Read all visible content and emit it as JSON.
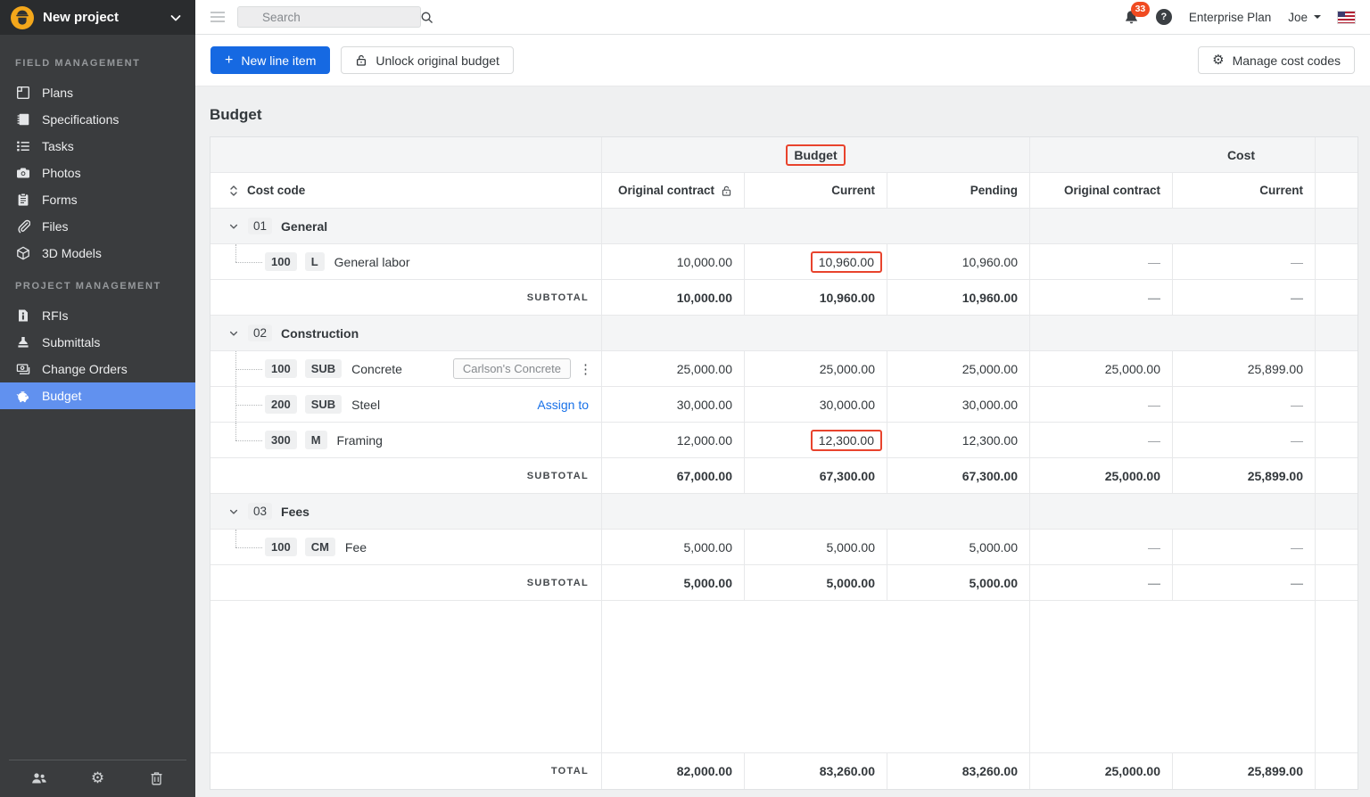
{
  "colors": {
    "accent_blue": "#1669E2",
    "sidebar_active_blue": "#6191EF",
    "annotation_red": "#E8432D",
    "notification_red": "#F04B21",
    "link_blue": "#1871E8"
  },
  "topbar": {
    "search_placeholder": "Search",
    "notification_count": "33",
    "help_label": "?",
    "plan_label": "Enterprise Plan",
    "user_name": "Joe"
  },
  "sidebar": {
    "project_name": "New project",
    "sections": [
      {
        "title": "FIELD MANAGEMENT",
        "items": [
          {
            "label": "Plans"
          },
          {
            "label": "Specifications"
          },
          {
            "label": "Tasks"
          },
          {
            "label": "Photos"
          },
          {
            "label": "Forms"
          },
          {
            "label": "Files"
          },
          {
            "label": "3D Models"
          }
        ]
      },
      {
        "title": "PROJECT MANAGEMENT",
        "items": [
          {
            "label": "RFIs"
          },
          {
            "label": "Submittals"
          },
          {
            "label": "Change Orders"
          },
          {
            "label": "Budget"
          }
        ]
      }
    ]
  },
  "toolbar": {
    "new_line_item": "New line item",
    "unlock_budget": "Unlock original budget",
    "manage_cost_codes": "Manage cost codes"
  },
  "page": {
    "title": "Budget"
  },
  "table": {
    "group_headers": {
      "budget": "Budget",
      "cost": "Cost"
    },
    "columns": {
      "cost_code": "Cost code",
      "original_contract": "Original contract",
      "current": "Current",
      "pending": "Pending"
    },
    "labels": {
      "subtotal": "SUBTOTAL",
      "total": "TOTAL"
    },
    "groups": [
      {
        "code": "01",
        "name": "General",
        "items": [
          {
            "code": "100",
            "type": "L",
            "name": "General labor",
            "values": [
              "10,000.00",
              "10,960.00",
              "10,960.00",
              "—",
              "—"
            ]
          }
        ],
        "subtotal": [
          "10,000.00",
          "10,960.00",
          "10,960.00",
          "—",
          "—"
        ]
      },
      {
        "code": "02",
        "name": "Construction",
        "items": [
          {
            "code": "100",
            "type": "SUB",
            "name": "Concrete",
            "vendor": "Carlson's Concrete",
            "values": [
              "25,000.00",
              "25,000.00",
              "25,000.00",
              "25,000.00",
              "25,899.00"
            ]
          },
          {
            "code": "200",
            "type": "SUB",
            "name": "Steel",
            "assign_link": "Assign to",
            "values": [
              "30,000.00",
              "30,000.00",
              "30,000.00",
              "—",
              "—"
            ]
          },
          {
            "code": "300",
            "type": "M",
            "name": "Framing",
            "values": [
              "12,000.00",
              "12,300.00",
              "12,300.00",
              "—",
              "—"
            ]
          }
        ],
        "subtotal": [
          "67,000.00",
          "67,300.00",
          "67,300.00",
          "25,000.00",
          "25,899.00"
        ]
      },
      {
        "code": "03",
        "name": "Fees",
        "items": [
          {
            "code": "100",
            "type": "CM",
            "name": "Fee",
            "values": [
              "5,000.00",
              "5,000.00",
              "5,000.00",
              "—",
              "—"
            ]
          }
        ],
        "subtotal": [
          "5,000.00",
          "5,000.00",
          "5,000.00",
          "—",
          "—"
        ]
      }
    ],
    "total": [
      "82,000.00",
      "83,260.00",
      "83,260.00",
      "25,000.00",
      "25,899.00"
    ]
  }
}
